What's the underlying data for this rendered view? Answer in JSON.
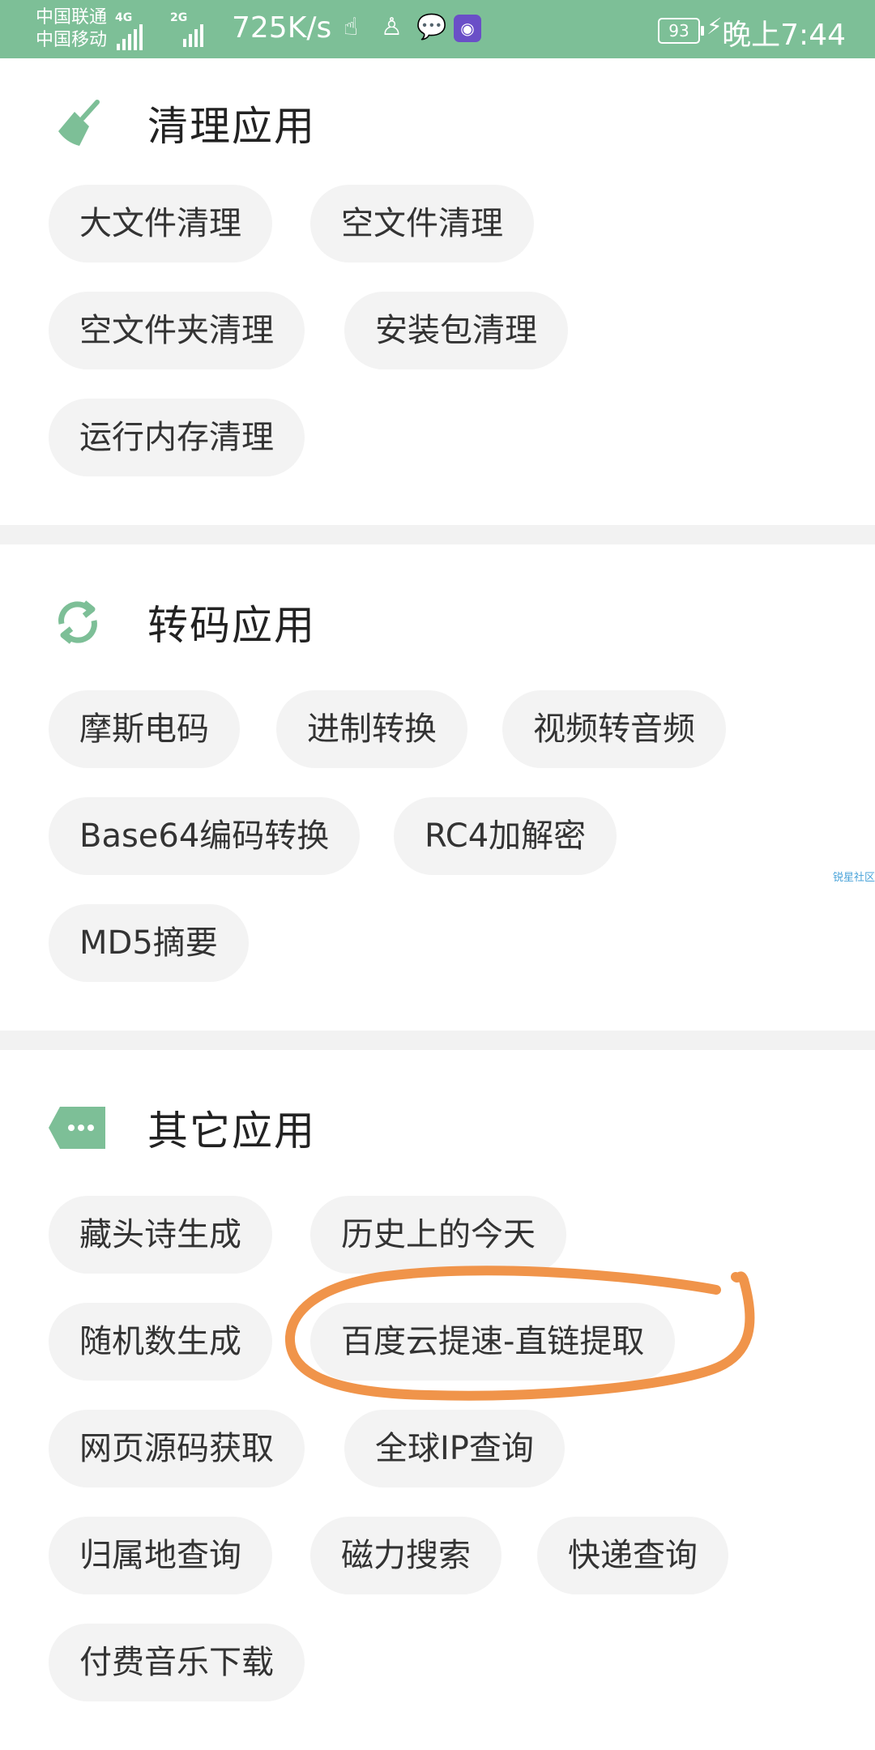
{
  "status_bar": {
    "carrier_1": "中国联通",
    "carrier_2": "中国移动",
    "net_1": "4G",
    "net_2": "2G",
    "speed": "725K/s",
    "battery": "93",
    "time": "晚上7:44"
  },
  "sections": [
    {
      "title": "清理应用",
      "icon": "broom-icon",
      "items": [
        "大文件清理",
        "空文件清理",
        "空文件夹清理",
        "安装包清理",
        "运行内存清理"
      ]
    },
    {
      "title": "转码应用",
      "icon": "refresh-icon",
      "items": [
        "摩斯电码",
        "进制转换",
        "视频转音频",
        "Base64编码转换",
        "RC4加解密",
        "MD5摘要"
      ]
    },
    {
      "title": "其它应用",
      "icon": "more-tag-icon",
      "items": [
        "藏头诗生成",
        "历史上的今天",
        "随机数生成",
        "百度云提速-直链提取",
        "网页源码获取",
        "全球IP查询",
        "归属地查询",
        "磁力搜索",
        "快递查询",
        "付费音乐下载"
      ]
    }
  ],
  "watermark": "锐星社区",
  "colors": {
    "accent": "#7dbf97",
    "chip_bg": "#f3f3f3",
    "annotation": "#f0944a"
  }
}
